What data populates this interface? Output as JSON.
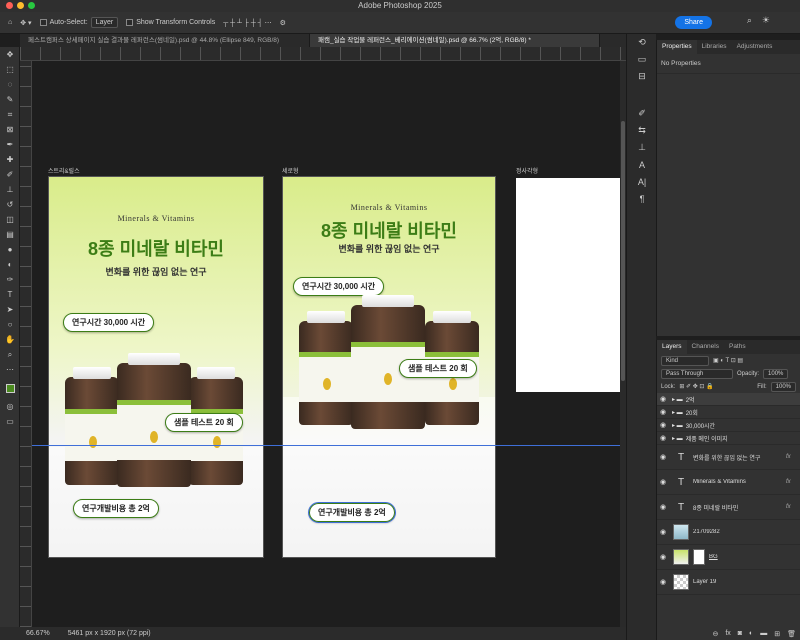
{
  "app": {
    "title": "Adobe Photoshop 2025",
    "share_label": "Share"
  },
  "options": {
    "auto_select_label": "Auto-Select:",
    "auto_select_value": "Layer",
    "transform_label": "Show Transform Controls"
  },
  "tabs": [
    {
      "label": "페스트캠퍼스 상세페이지 실습 결과물 레퍼런스(썸네일).psd @ 44.8% (Ellipse 849, RGB/8)"
    },
    {
      "label": "패캠_실습 작업물 레퍼런스_베리에이션(썸네일).psd @ 66.7% (2억, RGB/8) *"
    }
  ],
  "artboards": {
    "a1_label": "스트리&릴스",
    "a2_label": "세로형",
    "a3_label": "정사각형",
    "brand": "Minerals & Vitamins",
    "headline": "8종 미네랄 비타민",
    "subline": "변화를 위한 끊임 없는 연구",
    "pill_hours": "연구시간 30,000 시간",
    "pill_tests": "샘플 테스트 20 회",
    "pill_cost": "연구개발비용 총 2억"
  },
  "status": {
    "zoom": "66.67%",
    "doc_size": "5461 px x 1920 px (72 ppi)"
  },
  "properties": {
    "tabs": [
      "Properties",
      "Libraries",
      "Adjustments"
    ],
    "empty": "No Properties"
  },
  "layers_panel": {
    "tabs": [
      "Layers",
      "Channels",
      "Paths"
    ],
    "kind": "Kind",
    "blend": "Pass Through",
    "opacity_label": "Opacity:",
    "opacity": "100%",
    "lock_label": "Lock:",
    "fill_label": "Fill:",
    "fill": "100%",
    "layers": [
      {
        "name": "2억",
        "type": "group"
      },
      {
        "name": "20회",
        "type": "group"
      },
      {
        "name": "30,000시간",
        "type": "group"
      },
      {
        "name": "제품 메인 이미지",
        "type": "group"
      },
      {
        "name": "변화를 위한 끊임 없는 연구",
        "type": "text",
        "fx": "fx"
      },
      {
        "name": "Minerals & Vitamins",
        "type": "text",
        "fx": "fx"
      },
      {
        "name": "8종 미네랄 비타민",
        "type": "text",
        "fx": "fx"
      },
      {
        "name": "21709282",
        "type": "image"
      },
      {
        "name": "BG",
        "type": "image"
      },
      {
        "name": "Layer 19",
        "type": "image"
      }
    ]
  },
  "colors": {
    "accent": "#1473e6",
    "headline_green": "#3c7d16",
    "guide": "#3f6fd8"
  }
}
